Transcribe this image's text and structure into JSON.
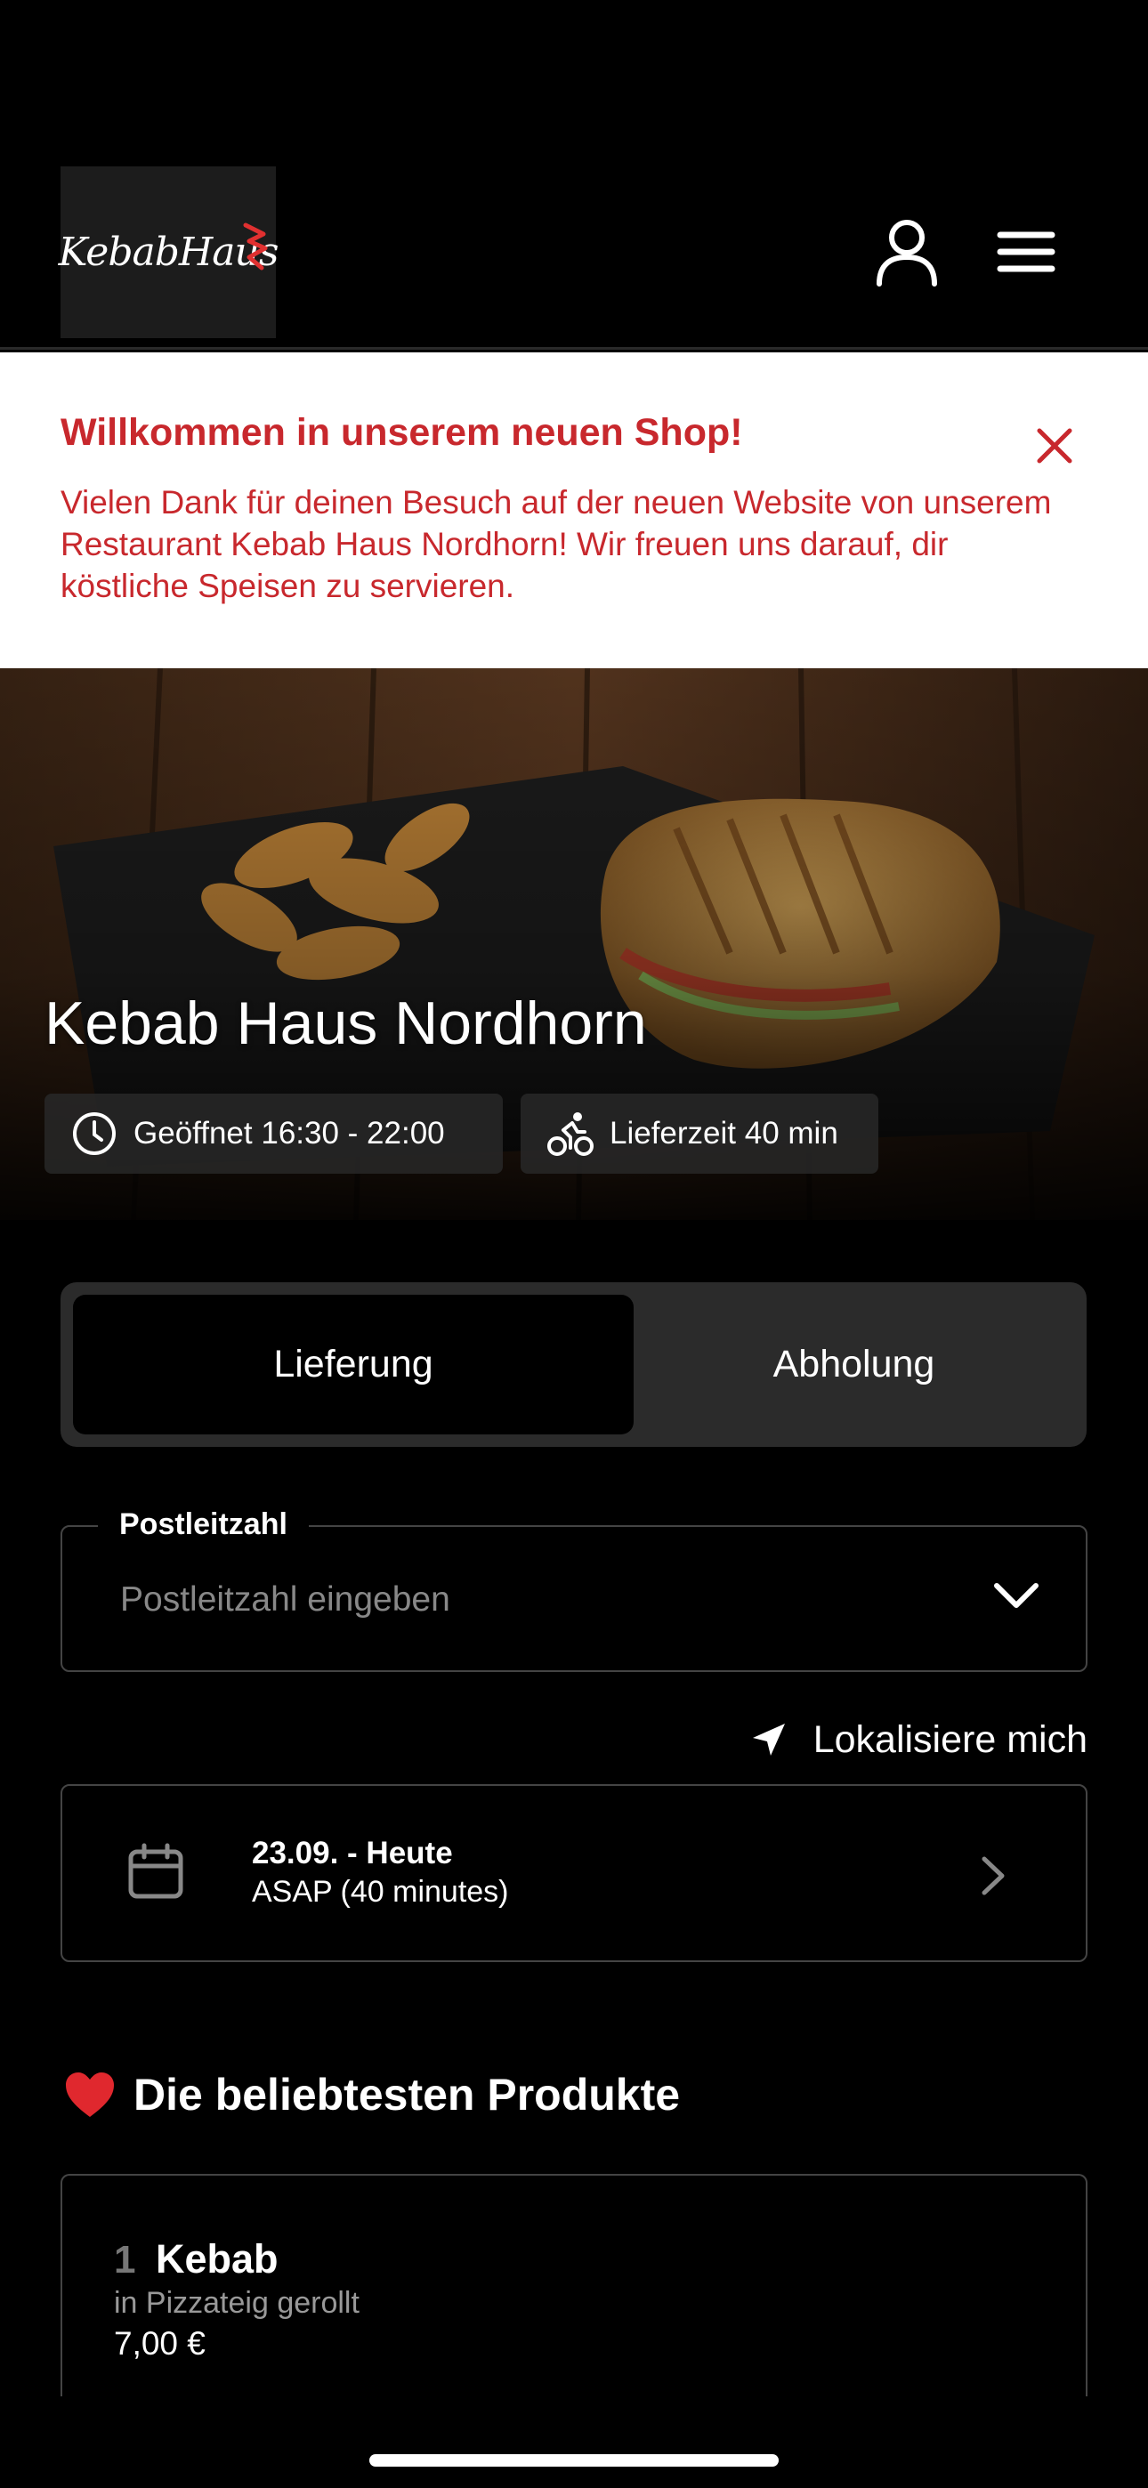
{
  "header": {
    "logo_text": "KebabHaus",
    "account_icon": "user-icon",
    "menu_icon": "hamburger-menu-icon"
  },
  "banner": {
    "title": "Willkommen in unserem neuen Shop!",
    "text": "Vielen Dank für deinen Besuch auf der neuen Website von unserem Restaurant Kebab Haus Nordhorn! Wir freuen uns darauf, dir köstliche Speisen zu servieren.",
    "close_icon": "close-icon",
    "accent_color": "#c8282d"
  },
  "hero": {
    "title": "Kebab Haus Nordhorn",
    "opening_hours": "Geöffnet 16:30 - 22:00",
    "delivery_time": "Lieferzeit 40 min",
    "opening_icon": "clock-icon",
    "delivery_icon": "bike-icon"
  },
  "order_mode": {
    "delivery_label": "Lieferung",
    "pickup_label": "Abholung",
    "selected": "Lieferung"
  },
  "postcode": {
    "label": "Postleitzahl",
    "placeholder": "Postleitzahl eingeben",
    "value": ""
  },
  "locate": {
    "label": "Lokalisiere mich",
    "icon": "location-arrow-icon"
  },
  "date_selector": {
    "title": "23.09. - Heute",
    "subtitle": "ASAP (40 minutes)",
    "icon": "calendar-icon"
  },
  "popular": {
    "title": "Die beliebtesten Produkte",
    "icon": "heart-icon",
    "products": [
      {
        "rank": "1",
        "name": "Kebab",
        "description": "in Pizzateig gerollt",
        "price": "7,00 €"
      }
    ]
  }
}
